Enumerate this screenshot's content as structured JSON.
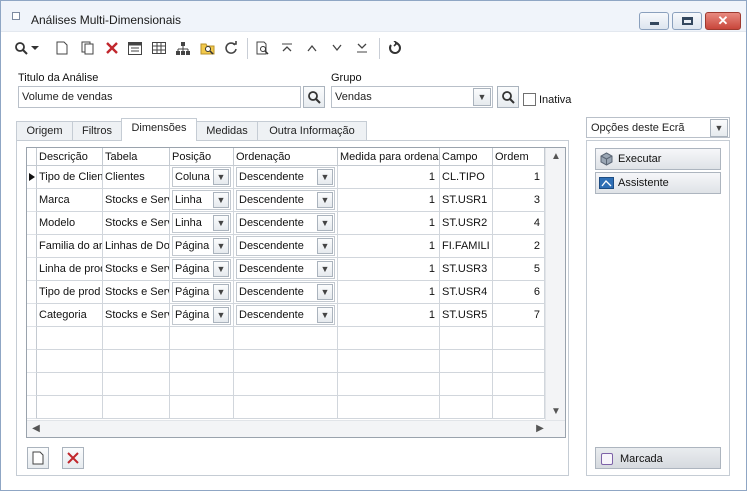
{
  "window": {
    "title": "Análises Multi-Dimensionais",
    "close_glyph": "✕"
  },
  "form": {
    "titulo_label": "Titulo da Análise",
    "titulo_value": "Volume de vendas",
    "grupo_label": "Grupo",
    "grupo_value": "Vendas",
    "inativa_label": "Inativa"
  },
  "tabs": [
    {
      "label": "Origem"
    },
    {
      "label": "Filtros"
    },
    {
      "label": "Dimensões"
    },
    {
      "label": "Medidas"
    },
    {
      "label": "Outra Informação"
    }
  ],
  "grid": {
    "headers": [
      "Descrição",
      "Tabela",
      "Posição",
      "Ordenação",
      "Medida para ordena",
      "Campo",
      "Ordem"
    ],
    "rows": [
      {
        "descricao": "Tipo de Clien",
        "tabela": "Clientes",
        "posicao": "Coluna",
        "ordenacao": "Descendente",
        "medida": "1",
        "campo": "CL.TIPO",
        "ordem": "1"
      },
      {
        "descricao": "Marca",
        "tabela": "Stocks e Serv",
        "posicao": "Linha",
        "ordenacao": "Descendente",
        "medida": "1",
        "campo": "ST.USR1",
        "ordem": "3"
      },
      {
        "descricao": "Modelo",
        "tabela": "Stocks e Serv",
        "posicao": "Linha",
        "ordenacao": "Descendente",
        "medida": "1",
        "campo": "ST.USR2",
        "ordem": "4"
      },
      {
        "descricao": "Familia do ar",
        "tabela": "Linhas de Doc",
        "posicao": "Página",
        "ordenacao": "Descendente",
        "medida": "1",
        "campo": "FI.FAMILI",
        "ordem": "2"
      },
      {
        "descricao": "Linha de prod",
        "tabela": "Stocks e Serv",
        "posicao": "Página",
        "ordenacao": "Descendente",
        "medida": "1",
        "campo": "ST.USR3",
        "ordem": "5"
      },
      {
        "descricao": "Tipo de prod",
        "tabela": "Stocks e Serv",
        "posicao": "Página",
        "ordenacao": "Descendente",
        "medida": "1",
        "campo": "ST.USR4",
        "ordem": "6"
      },
      {
        "descricao": "Categoria",
        "tabela": "Stocks e Serv",
        "posicao": "Página",
        "ordenacao": "Descendente",
        "medida": "1",
        "campo": "ST.USR5",
        "ordem": "7"
      }
    ]
  },
  "right_panel": {
    "options_combo": "Opções deste Ecrã",
    "executar_label": "Executar",
    "assistente_label": "Assistente",
    "marcada_label": "Marcada"
  },
  "icons": {
    "toolbar": [
      "search-icon",
      "dropdown-arrow-icon",
      "new-document-icon",
      "copy-icon",
      "delete-icon",
      "list-view-icon",
      "table-icon",
      "hierarchy-icon",
      "find-folder-icon",
      "refresh-icon",
      "preview-icon",
      "first-record-icon",
      "previous-record-icon",
      "next-record-icon",
      "last-record-icon",
      "reload-icon"
    ]
  }
}
